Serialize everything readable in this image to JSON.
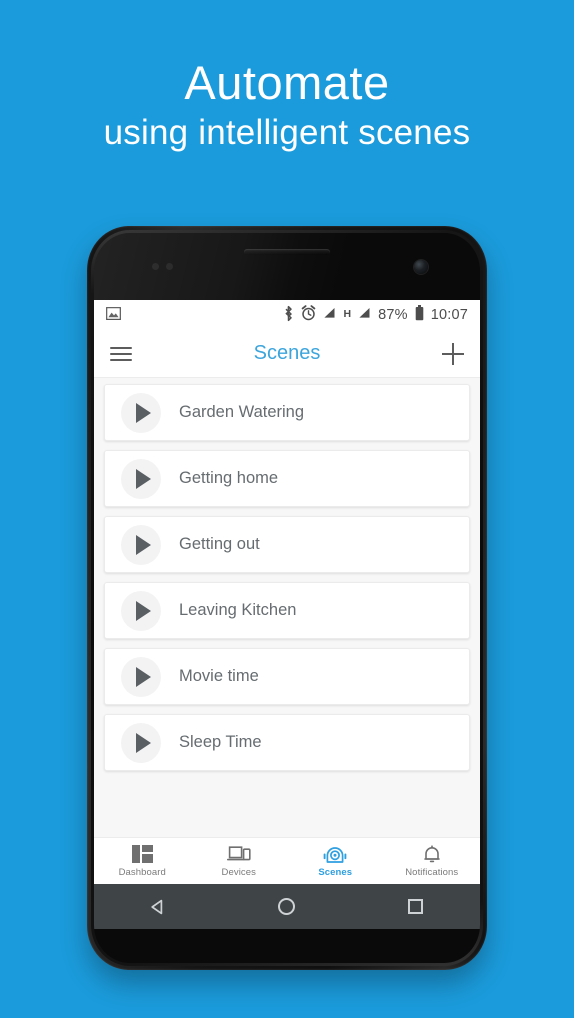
{
  "theme": {
    "background_blue": "#1b9bdb",
    "accent_blue": "#3ca5dc",
    "nav_active_blue": "#2e9fe0",
    "card_white": "#ffffff",
    "list_background": "#f7f7f7",
    "text_gray": "#666c70"
  },
  "headline": {
    "line1": "Automate",
    "line2": "using intelligent scenes"
  },
  "phone": {
    "status_bar": {
      "left_icons": [
        "image-icon"
      ],
      "right_icons": [
        "bluetooth-icon",
        "alarm-icon",
        "signal-icon",
        "battery-icon"
      ],
      "network_type": "H",
      "battery_percent": "87%",
      "time": "10:07"
    },
    "app_bar": {
      "menu_icon": "hamburger-menu-icon",
      "title": "Scenes",
      "add_icon": "plus-icon"
    },
    "scenes": [
      {
        "name": "Garden Watering",
        "icon": "play-icon"
      },
      {
        "name": "Getting home",
        "icon": "play-icon"
      },
      {
        "name": "Getting out",
        "icon": "play-icon"
      },
      {
        "name": "Leaving Kitchen",
        "icon": "play-icon"
      },
      {
        "name": "Movie time",
        "icon": "play-icon"
      },
      {
        "name": "Sleep Time",
        "icon": "play-icon"
      }
    ],
    "bottom_nav": [
      {
        "label": "Dashboard",
        "icon": "dashboard-grid-icon",
        "active": false
      },
      {
        "label": "Devices",
        "icon": "devices-icon",
        "active": false
      },
      {
        "label": "Scenes",
        "icon": "robot-scenes-icon",
        "active": true
      },
      {
        "label": "Notifications",
        "icon": "bell-icon",
        "active": false
      }
    ],
    "android_nav": {
      "back": "back-triangle-icon",
      "home": "home-circle-icon",
      "recents": "recents-square-icon"
    }
  }
}
